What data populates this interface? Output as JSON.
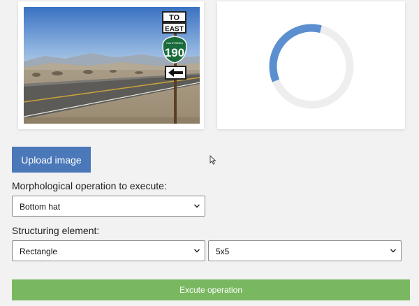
{
  "upload": {
    "label": "Upload image"
  },
  "photo": {
    "sign_top": "TO",
    "sign_dir": "EAST",
    "shield_state": "CALIFORNIA",
    "shield_number": "190"
  },
  "result": {
    "loading_progress": 0.35
  },
  "operation": {
    "label": "Morphological operation to execute:",
    "selected": "Bottom hat"
  },
  "structuring": {
    "label": "Structuring element:",
    "shape_selected": "Rectangle",
    "size_selected": "5x5"
  },
  "execute": {
    "label": "Excute operation"
  },
  "colors": {
    "upload_button": "#4a78b9",
    "execute_button": "#79b860",
    "spinner_arc": "#5b8fd0",
    "spinner_track": "#eeeeee"
  }
}
